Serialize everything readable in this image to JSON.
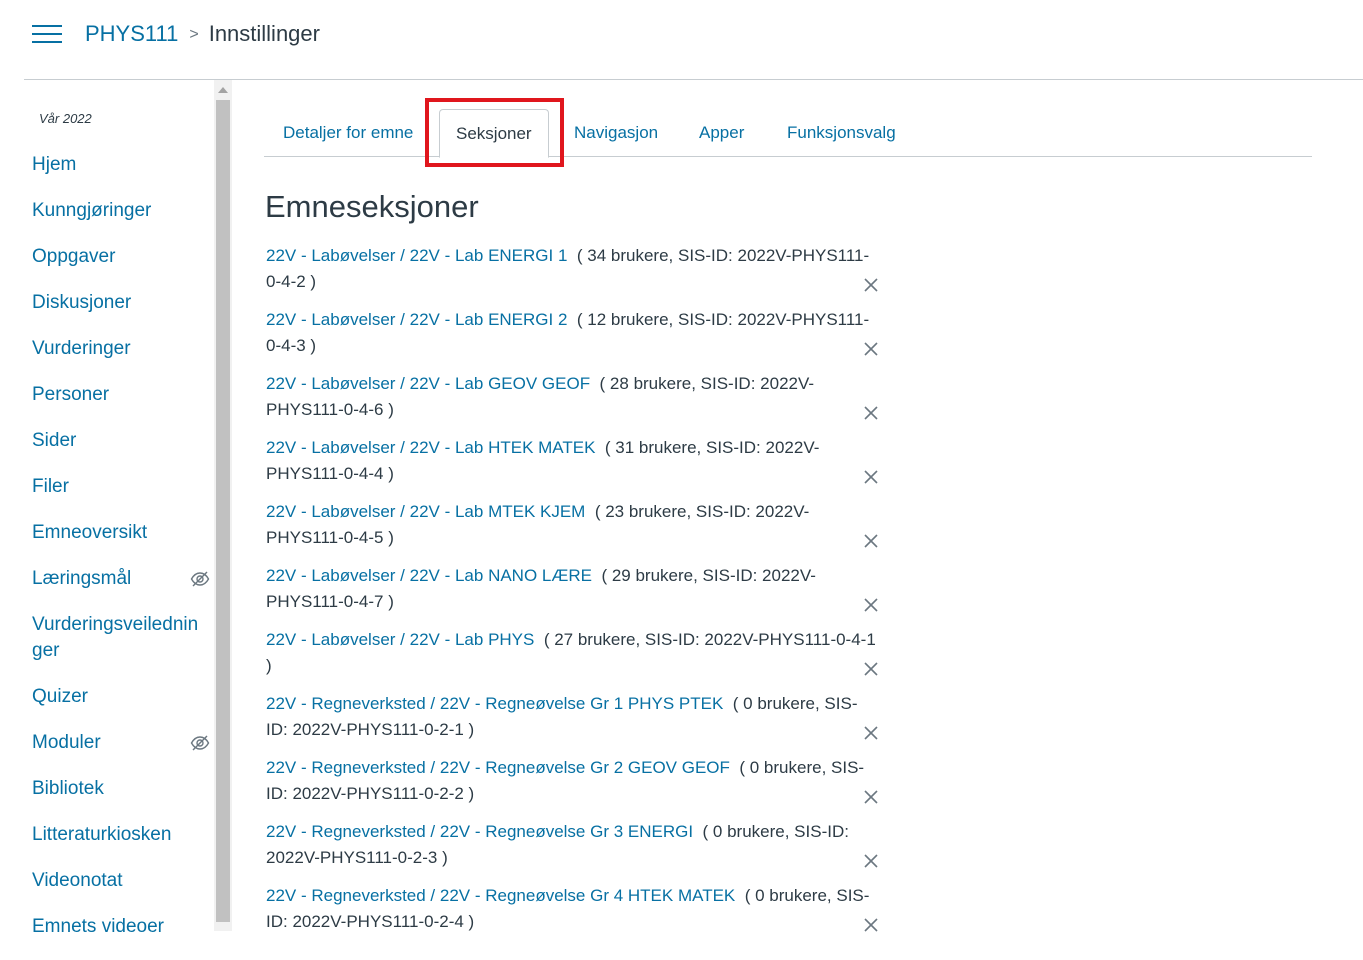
{
  "header": {
    "course": "PHYS111",
    "separator": ">",
    "current": "Innstillinger"
  },
  "sidebar": {
    "term": "Vår 2022",
    "items": [
      {
        "label": "Hjem"
      },
      {
        "label": "Kunngjøringer"
      },
      {
        "label": "Oppgaver"
      },
      {
        "label": "Diskusjoner"
      },
      {
        "label": "Vurderinger"
      },
      {
        "label": "Personer"
      },
      {
        "label": "Sider"
      },
      {
        "label": "Filer"
      },
      {
        "label": "Emneoversikt"
      },
      {
        "label": "Læringsmål",
        "hidden_icon": "eye-slash-icon"
      },
      {
        "label": "Vurderingsveiledninger"
      },
      {
        "label": "Quizer"
      },
      {
        "label": "Moduler",
        "hidden_icon": "eye-slash-icon"
      },
      {
        "label": "Bibliotek"
      },
      {
        "label": "Litteraturkiosken"
      },
      {
        "label": "Videonotat"
      },
      {
        "label": "Emnets videoer"
      }
    ]
  },
  "tabs": [
    {
      "label": "Detaljer for emne"
    },
    {
      "label": "Seksjoner",
      "active": true
    },
    {
      "label": "Navigasjon"
    },
    {
      "label": "Apper"
    },
    {
      "label": "Funksjonsvalg"
    }
  ],
  "main": {
    "title": "Emneseksjoner",
    "sections": [
      {
        "name": "22V - Labøvelser / 22V - Lab ENERGI 1",
        "info": "( 34 brukere, SIS-ID: 2022V-PHYS111-0-4-2 )"
      },
      {
        "name": "22V - Labøvelser / 22V - Lab ENERGI 2",
        "info": "( 12 brukere, SIS-ID: 2022V-PHYS111-0-4-3 )"
      },
      {
        "name": "22V - Labøvelser / 22V - Lab GEOV GEOF",
        "info": "( 28 brukere, SIS-ID: 2022V-PHYS111-0-4-6 )"
      },
      {
        "name": "22V - Labøvelser / 22V - Lab HTEK MATEK",
        "info": "( 31 brukere, SIS-ID: 2022V-PHYS111-0-4-4 )"
      },
      {
        "name": "22V - Labøvelser / 22V - Lab MTEK KJEM",
        "info": "( 23 brukere, SIS-ID: 2022V-PHYS111-0-4-5 )"
      },
      {
        "name": "22V - Labøvelser / 22V - Lab NANO LÆRE",
        "info": "( 29 brukere, SIS-ID: 2022V-PHYS111-0-4-7 )"
      },
      {
        "name": "22V - Labøvelser / 22V - Lab PHYS",
        "info": "( 27 brukere, SIS-ID: 2022V-PHYS111-0-4-1 )"
      },
      {
        "name": "22V - Regneverksted / 22V - Regneøvelse Gr 1 PHYS PTEK",
        "info": "( 0 brukere, SIS-ID: 2022V-PHYS111-0-2-1 )"
      },
      {
        "name": "22V - Regneverksted / 22V - Regneøvelse Gr 2 GEOV GEOF",
        "info": "( 0 brukere, SIS-ID: 2022V-PHYS111-0-2-2 )"
      },
      {
        "name": "22V - Regneverksted / 22V - Regneøvelse Gr 3 ENERGI",
        "info": "( 0 brukere, SIS-ID: 2022V-PHYS111-0-2-3 )"
      },
      {
        "name": "22V - Regneverksted / 22V - Regneøvelse Gr 4 HTEK MATEK",
        "info": "( 0 brukere, SIS-ID: 2022V-PHYS111-0-2-4 )"
      }
    ]
  },
  "colors": {
    "link": "#0770a3",
    "text": "#2d3b45",
    "highlight": "#e0161d"
  }
}
